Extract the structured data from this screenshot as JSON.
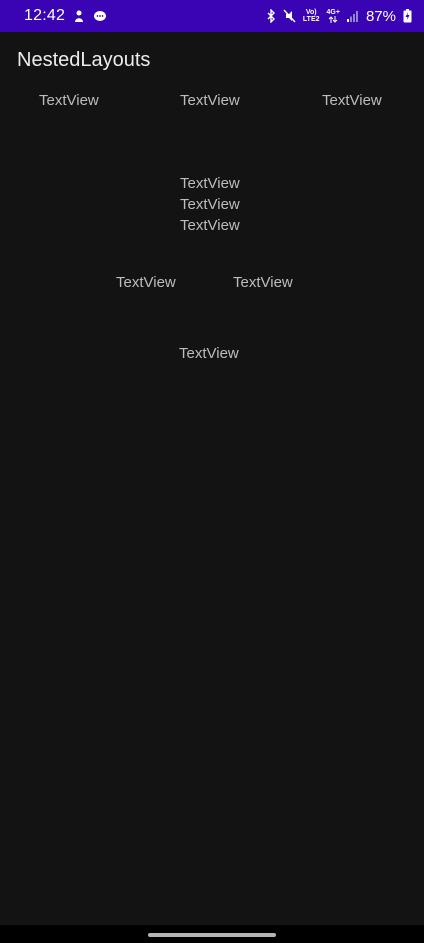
{
  "status_bar": {
    "time": "12:42",
    "network_top": "Vo)",
    "network_bottom": "LTE2",
    "signal_gen": "4G+",
    "battery": "87%",
    "bg_color": "#3a04b5"
  },
  "app": {
    "title": "NestedLayouts"
  },
  "row1": [
    "TextView",
    "TextView",
    "TextView"
  ],
  "column": [
    "TextView",
    "TextView",
    "TextView"
  ],
  "row2": [
    "TextView",
    "TextView"
  ],
  "single": "TextView"
}
